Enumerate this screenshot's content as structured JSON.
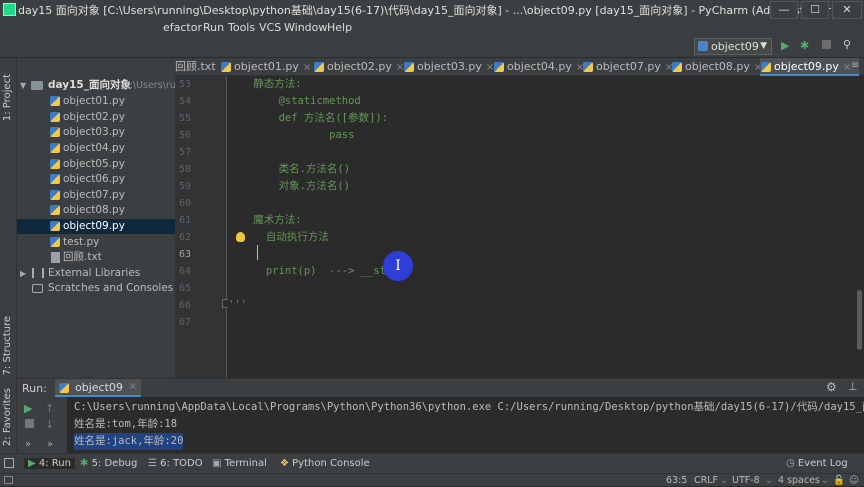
{
  "window": {
    "title": "day15  面向对象 [C:\\Users\\running\\Desktop\\python基础\\day15(6-17)\\代码\\day15_面向对象] - ...\\object09.py [day15_面向对象] - PyCharm (Administrator)",
    "minimize": "—",
    "maximize": "☐",
    "close": "✕"
  },
  "menu": [
    "efactor",
    "Run",
    "Tools",
    "VCS",
    "Window",
    "Help"
  ],
  "toolbar": {
    "run_config": "object09",
    "run_icon": "run-icon",
    "debug_icon": "debug-icon",
    "stop_icon": "stop-icon",
    "search_icon": "search-icon"
  },
  "tabs": [
    {
      "label": "回顾.txt"
    },
    {
      "label": "object01.py"
    },
    {
      "label": "object02.py"
    },
    {
      "label": "object03.py"
    },
    {
      "label": "object04.py"
    },
    {
      "label": "object07.py"
    },
    {
      "label": "object08.py"
    },
    {
      "label": "object09.py"
    }
  ],
  "sidebar_labels": {
    "project": "1: Project",
    "structure": "7: Structure",
    "favorites": "2: Favorites"
  },
  "project_tree": {
    "root": "day15_面向对象",
    "root_path": "C:\\Users\\running",
    "files": [
      "object01.py",
      "object02.py",
      "object03.py",
      "object04.py",
      "object05.py",
      "object06.py",
      "object07.py",
      "object08.py",
      "object09.py",
      "test.py",
      "回顾.txt"
    ],
    "external": "External Libraries",
    "scratches": "Scratches and Consoles"
  },
  "editor": {
    "line_numbers": [
      "53",
      "54",
      "55",
      "56",
      "57",
      "58",
      "59",
      "60",
      "61",
      "62",
      "63",
      "64",
      "65",
      "66",
      "67"
    ],
    "lines": [
      "    静态方法:",
      "        @staticmethod",
      "        def 方法名([参数]):",
      "                pass",
      "",
      "        类名.方法名()",
      "        对象.方法名()",
      "",
      "    魔术方法:",
      "      自动执行方法",
      "",
      "      print(p)  ---> __str__",
      "",
      "'''",
      ""
    ]
  },
  "run_panel": {
    "label": "Run:",
    "config_tab": "object09",
    "console": [
      "C:\\Users\\running\\AppData\\Local\\Programs\\Python\\Python36\\python.exe C:/Users/running/Desktop/python基础/day15(6-17)/代码/day15_面向",
      "姓名是:tom,年龄:18",
      "姓名是:jack,年龄:20"
    ]
  },
  "bottom_tabs": [
    "4: Run",
    "5: Debug",
    "6: TODO",
    "Terminal",
    "Python Console"
  ],
  "event_log": "Event Log",
  "status": {
    "position": "63:5",
    "line_sep": "CRLF",
    "encoding": "UTF-8",
    "indent": "4 spaces"
  },
  "colors": {
    "bg": "#2b2b2b",
    "panel": "#3c3f41",
    "docstring": "#629755",
    "selection": "#214283",
    "cursor_highlight": "#2f3ed8"
  }
}
